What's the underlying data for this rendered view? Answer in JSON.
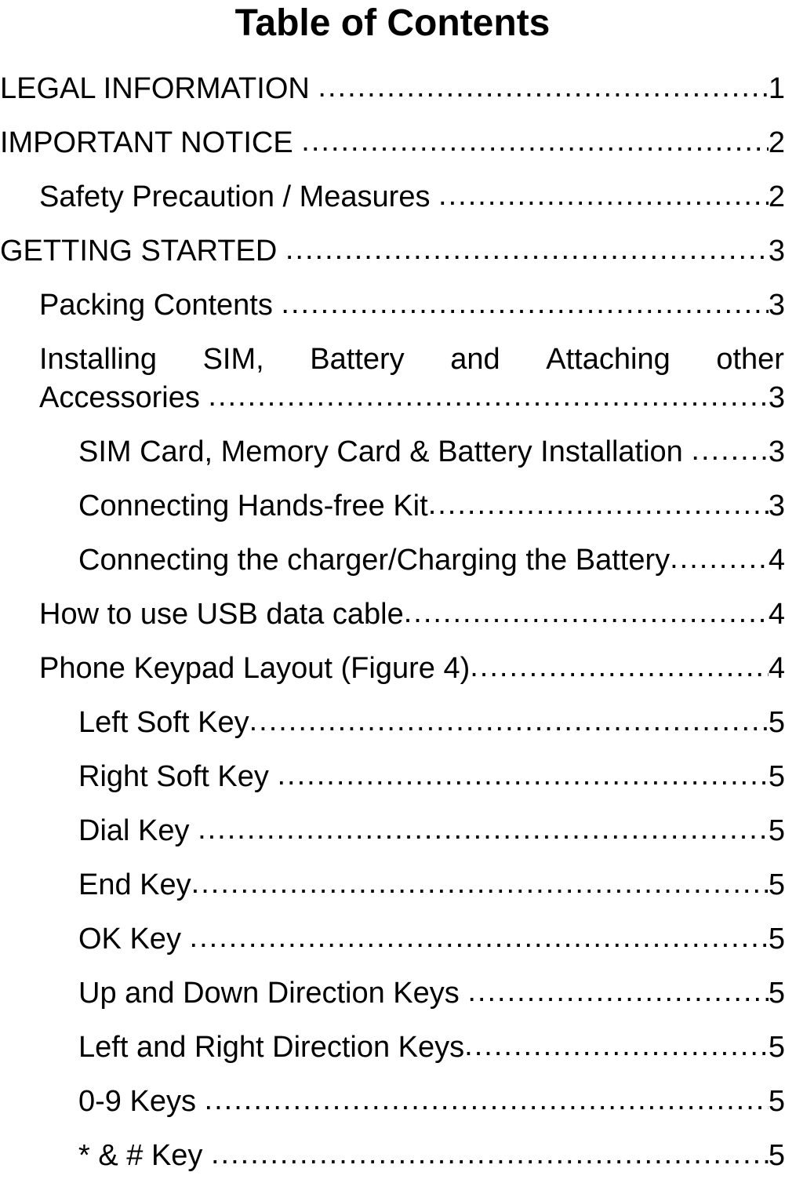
{
  "document": {
    "title": "Table of Contents"
  },
  "toc": {
    "entries": [
      {
        "label": "LEGAL INFORMATION",
        "gap": " ",
        "page": "1",
        "level": 0,
        "wrapped": false
      },
      {
        "label": "IMPORTANT NOTICE",
        "gap": " ",
        "page": "2",
        "level": 0,
        "wrapped": false
      },
      {
        "label": "Safety Precaution / Measures",
        "gap": " ",
        "page": "2",
        "level": 1,
        "wrapped": false
      },
      {
        "label": "GETTING STARTED",
        "gap": " ",
        "page": "3",
        "level": 0,
        "wrapped": false
      },
      {
        "label": "Packing Contents",
        "gap": " ",
        "page": "3",
        "level": 1,
        "wrapped": false
      },
      {
        "label": "Installing SIM, Battery and Attaching other Accessories",
        "line1_words": [
          "Installing",
          "SIM,",
          "Battery",
          "and",
          "Attaching",
          "other"
        ],
        "line2": "Accessories",
        "gap": " ",
        "page": "3",
        "level": 1,
        "wrapped": true
      },
      {
        "label": "SIM Card, Memory Card & Battery Installation",
        "gap": " ",
        "page": "3",
        "level": 2,
        "wrapped": false
      },
      {
        "label": "Connecting Hands-free Kit",
        "gap": "",
        "page": "3",
        "level": 2,
        "wrapped": false
      },
      {
        "label": "Connecting the charger/Charging the Battery",
        "gap": "",
        "page": "4",
        "level": 2,
        "wrapped": false
      },
      {
        "label": "How to use USB data cable",
        "gap": "",
        "page": "4",
        "level": 1,
        "wrapped": false
      },
      {
        "label": "Phone Keypad Layout (Figure 4)",
        "gap": "",
        "page": "4",
        "level": 1,
        "wrapped": false
      },
      {
        "label": "Left Soft Key",
        "gap": "",
        "page": "5",
        "level": 2,
        "wrapped": false
      },
      {
        "label": "Right Soft Key",
        "gap": " ",
        "page": "5",
        "level": 2,
        "wrapped": false
      },
      {
        "label": "Dial Key",
        "gap": " ",
        "page": "5",
        "level": 2,
        "wrapped": false
      },
      {
        "label": "End Key",
        "gap": "",
        "page": "5",
        "level": 2,
        "wrapped": false
      },
      {
        "label": "OK Key",
        "gap": " ",
        "page": "5",
        "level": 2,
        "wrapped": false
      },
      {
        "label": "Up and Down Direction Keys",
        "gap": " ",
        "page": "5",
        "level": 2,
        "wrapped": false
      },
      {
        "label": "Left and Right Direction Keys",
        "gap": "",
        "page": "5",
        "level": 2,
        "wrapped": false
      },
      {
        "label": "0-9 Keys",
        "gap": " ",
        "page": "5",
        "level": 2,
        "wrapped": false
      },
      {
        "label": "* & # Key",
        "gap": " ",
        "page": "5",
        "level": 2,
        "wrapped": false
      }
    ],
    "leader_char": "."
  }
}
